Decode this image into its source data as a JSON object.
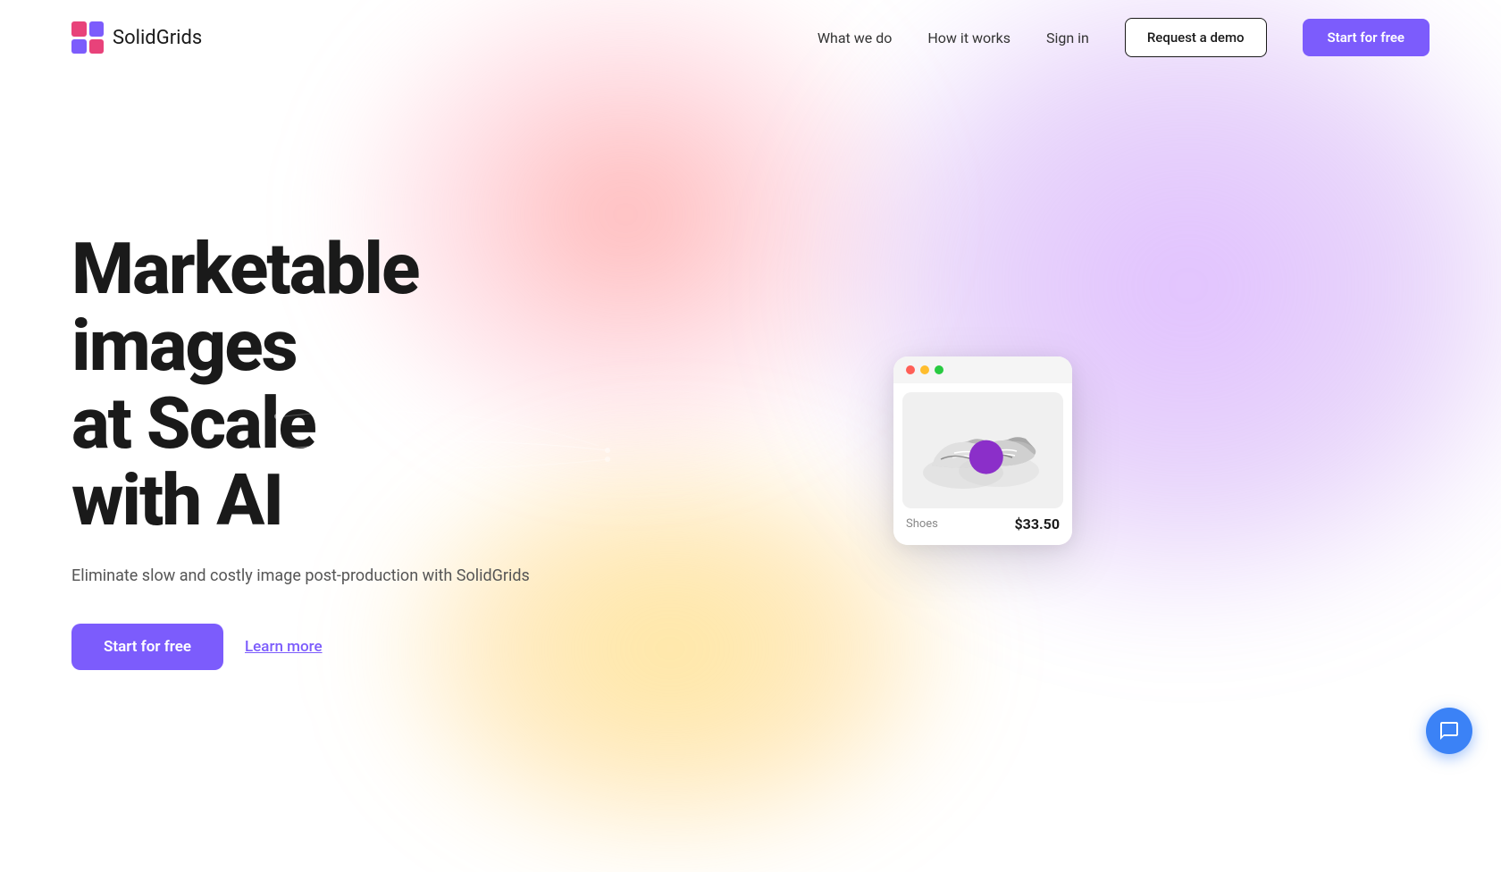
{
  "brand": {
    "name_bold": "Solid",
    "name_light": "Grids"
  },
  "nav": {
    "links": [
      {
        "id": "what-we-do",
        "label": "What we do"
      },
      {
        "id": "how-it-works",
        "label": "How it works"
      },
      {
        "id": "sign-in",
        "label": "Sign in"
      }
    ],
    "demo_button": "Request a demo",
    "start_button": "Start for free"
  },
  "hero": {
    "title_line1": "Marketable",
    "title_line2": "images",
    "title_line3": "at Scale",
    "title_line4": "with AI",
    "subtitle": "Eliminate slow and costly image post-production with SolidGrids",
    "start_button": "Start for free",
    "learn_button": "Learn more"
  },
  "product_card": {
    "shoe_label": "Shoes",
    "shoe_price": "$33.50"
  },
  "chat": {
    "label": "Open chat"
  }
}
